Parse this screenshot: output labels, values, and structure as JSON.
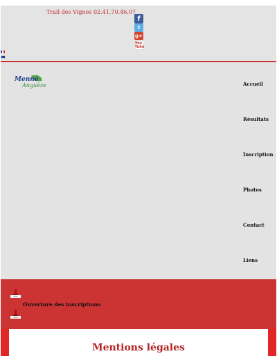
{
  "header": {
    "title": "Trail des Vignes 02.41.70.46.07",
    "social": [
      {
        "name": "facebook",
        "glyph": "f",
        "color": "#3b5a98"
      },
      {
        "name": "twitter",
        "glyph": "t",
        "color": "#5faee3"
      },
      {
        "name": "google-plus",
        "glyph": "g+",
        "color": "#d3452f"
      },
      {
        "name": "youtube",
        "glyph": "You Tube",
        "color": "#c4302b"
      }
    ],
    "languages": [
      "fr",
      "en"
    ]
  },
  "logo": {
    "line1": "Menne",
    "line2": "Anguèze"
  },
  "nav": {
    "items": [
      {
        "label": "Accueil"
      },
      {
        "label": "Résultats"
      },
      {
        "label": "Inscription"
      },
      {
        "label": "Photos"
      },
      {
        "label": "Contact"
      },
      {
        "label": "Liens"
      }
    ]
  },
  "news": {
    "icon_label": "Info",
    "item": "Ouverture des inscriptions"
  },
  "content": {
    "title": "Mentions légales"
  },
  "colors": {
    "accent": "#cc3333",
    "title": "#b22222",
    "background": "#e3e3e3"
  }
}
